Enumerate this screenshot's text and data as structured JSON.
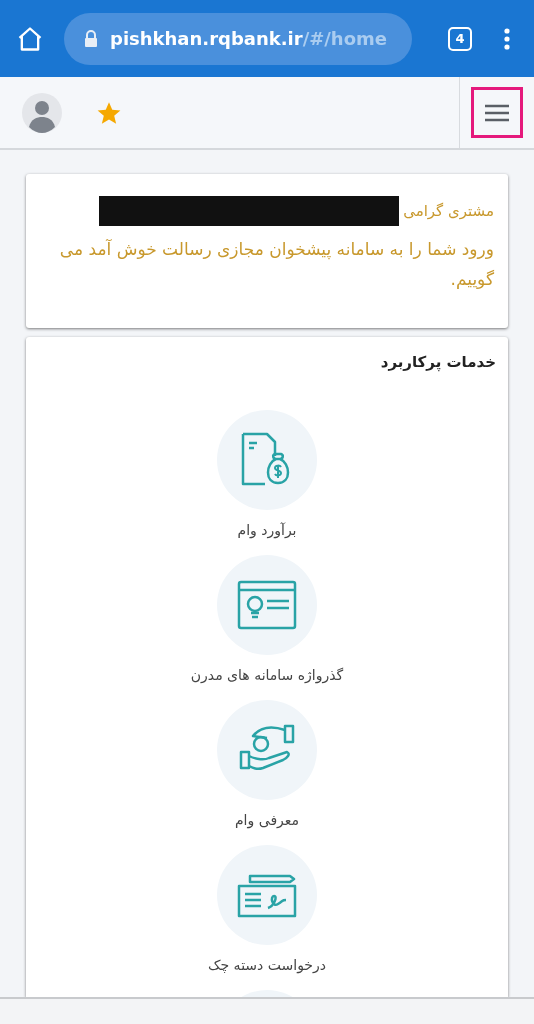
{
  "browser": {
    "url_host": "pishkhan.rqbank.ir",
    "url_path": "/#/home",
    "tab_count": "4"
  },
  "welcome": {
    "greeting": "مشتری گرامی",
    "message": "ورود شما را به سامانه پیشخوان مجازی رسالت خوش آمد می گوییم."
  },
  "services": {
    "title": "خدمات پرکاربرد",
    "items": [
      {
        "kind": "loan-estimate",
        "label": "برآورد وام"
      },
      {
        "kind": "password",
        "label": "گذرواژه سامانه های مدرن"
      },
      {
        "kind": "loan-intro",
        "label": "معرفی وام"
      },
      {
        "kind": "checkbook",
        "label": "درخواست دسته چک"
      }
    ]
  }
}
